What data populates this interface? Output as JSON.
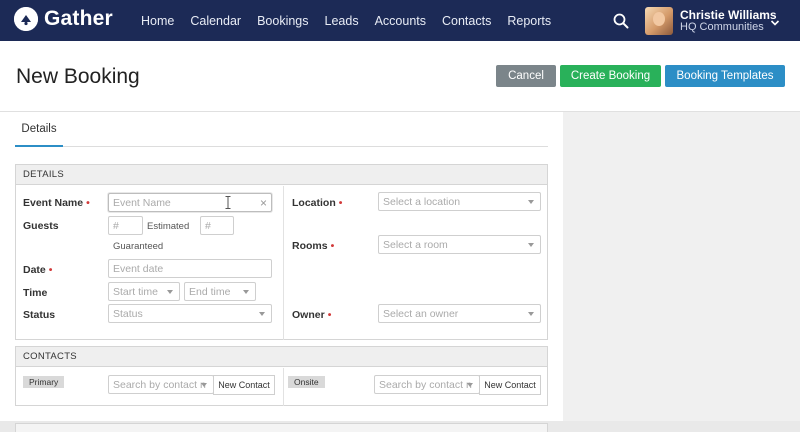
{
  "app": {
    "name": "Gather"
  },
  "nav": {
    "items": [
      "Home",
      "Calendar",
      "Bookings",
      "Leads",
      "Accounts",
      "Contacts",
      "Reports"
    ]
  },
  "user": {
    "name": "Christie Williams",
    "org": "HQ Communities"
  },
  "page": {
    "title": "New Booking"
  },
  "actions": {
    "cancel": "Cancel",
    "create": "Create Booking",
    "templates": "Booking Templates"
  },
  "tabs": {
    "details": "Details"
  },
  "details": {
    "header": "DETAILS",
    "event_name": {
      "label": "Event Name",
      "placeholder": "Event Name"
    },
    "guests": {
      "label": "Guests",
      "estimated_placeholder": "#",
      "estimated_label": "Estimated",
      "guaranteed_placeholder": "#",
      "guaranteed_label": "Guaranteed"
    },
    "date": {
      "label": "Date",
      "placeholder": "Event date"
    },
    "time": {
      "label": "Time",
      "start_placeholder": "Start time",
      "end_placeholder": "End time"
    },
    "status": {
      "label": "Status",
      "placeholder": "Status"
    },
    "location": {
      "label": "Location",
      "placeholder": "Select a location"
    },
    "rooms": {
      "label": "Rooms",
      "placeholder": "Select a room"
    },
    "owner": {
      "label": "Owner",
      "placeholder": "Select an owner"
    }
  },
  "contacts": {
    "header": "CONTACTS",
    "primary": {
      "tag": "Primary",
      "placeholder": "Search by contact n",
      "new_button": "New Contact"
    },
    "onsite": {
      "tag": "Onsite",
      "placeholder": "Search by contact n",
      "new_button": "New Contact"
    }
  },
  "colors": {
    "nav_bg": "#1c2a56",
    "cancel": "#7b858a",
    "create": "#29b15a",
    "templates": "#2c8ec6",
    "required": "#d23a3a"
  },
  "icons": {
    "search": "search-icon",
    "chevron": "chevron-down-icon",
    "logo": "gather-logo-icon"
  }
}
